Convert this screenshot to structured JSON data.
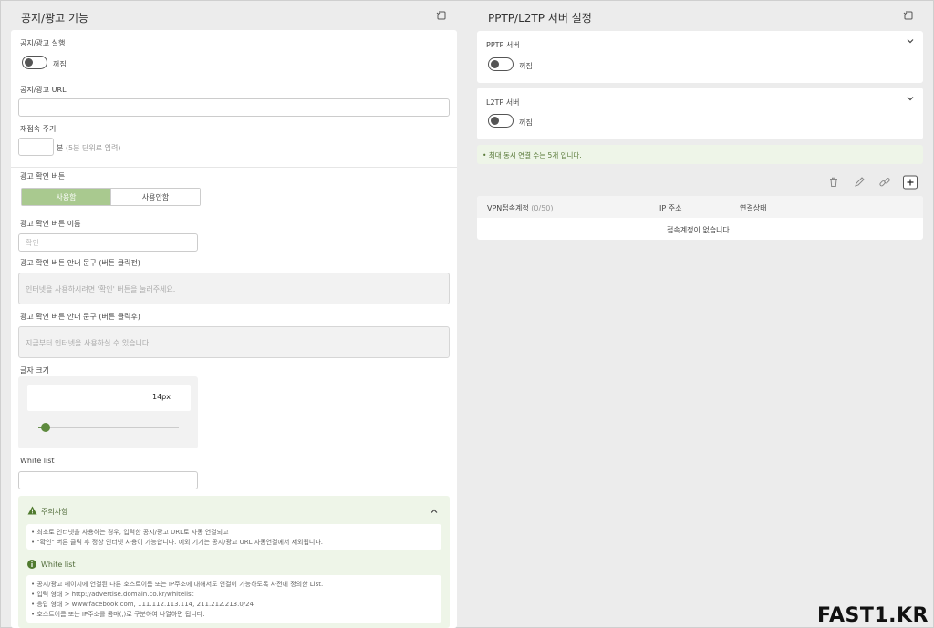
{
  "left": {
    "title": "공지/광고 기능",
    "run_label": "공지/광고 실행",
    "run_state": "꺼짐",
    "url_label": "공지/광고 URL",
    "url_value": "",
    "reconnect_label": "재접속 주기",
    "reconnect_value": "",
    "reconnect_unit": "분",
    "reconnect_hint": "(5분 단위로 입력)",
    "confirm_btn_label": "광고 확인 버튼",
    "seg_use": "사용함",
    "seg_nouse": "사용안함",
    "confirm_name_label": "광고 확인 버튼 이름",
    "confirm_name_placeholder": "확인",
    "guide_before_label": "광고 확인 버튼 안내 문구 (버튼 클릭전)",
    "guide_before_placeholder": "인터넷을 사용하시려면 '확인' 버튼을 눌러주세요.",
    "guide_after_label": "광고 확인 버튼 안내 문구 (버튼 클릭후)",
    "guide_after_placeholder": "지금부터 인터넷을 사용하실 수 있습니다.",
    "font_size_label": "글자 크기",
    "font_size_value": "14px",
    "font_size_slider_fraction": 0.05,
    "whitelist_label": "White list",
    "whitelist_value": "",
    "caution_title": "주의사항",
    "caution_lines": [
      "• 최초로 인터넷을 사용하는 경우, 입력한 공지/광고 URL로 자동 연결되고",
      "• \"확인\" 버튼 클릭 후 정상 인터넷 사용이 가능합니다. 예외 기기는 공지/광고 URL 자동연결에서 제외됩니다."
    ],
    "whitelist_info_title": "White list",
    "whitelist_lines": [
      "• 공지/광고 페이지에 연결된 다른 호스트이름 또는 IP주소에 대해서도 연결이 가능하도록 사전에 정의한 List.",
      "• 입력 형태 > http://advertise.domain.co.kr/whitelist",
      "• 응답 형태 > www.facebook.com, 111.112.113.114, 211.212.213.0/24",
      "• 호스트이름 또는 IP주소를 콤마(,)로 구분하여 나열하면 됩니다."
    ]
  },
  "right": {
    "title": "PPTP/L2TP 서버 설정",
    "pptp_label": "PPTP 서버",
    "pptp_state": "꺼짐",
    "l2tp_label": "L2TP 서버",
    "l2tp_state": "꺼짐",
    "max_conn_note": "• 최대 동시 연결 수는 5개 입니다.",
    "table_headers": [
      "VPN접속계정",
      "IP 주소",
      "연결상태"
    ],
    "account_count": "(0/50)",
    "empty_message": "접속계정이 없습니다."
  },
  "icons": [
    "refresh-icon",
    "chevron-down-icon",
    "chevron-up-icon",
    "warning-icon",
    "info-icon",
    "trash-icon",
    "edit-icon",
    "link-icon",
    "plus-icon"
  ],
  "colors": {
    "accent_green": "#a9c98f",
    "note_bg": "#eef5e8",
    "note_text": "#5a7a3a"
  },
  "watermark": "FAST1.KR"
}
